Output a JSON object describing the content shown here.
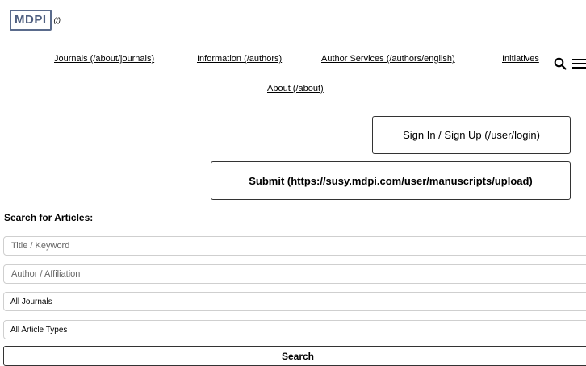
{
  "logo": {
    "text": "MDPI",
    "alt_text": "(/)"
  },
  "nav": {
    "items": [
      "Journals (/about/journals)",
      "Information (/authors)",
      "Author Services (/authors/english)",
      "Initiatives",
      "About (/about)"
    ]
  },
  "icons": {
    "search": "search-icon",
    "menu": "hamburger-menu-icon"
  },
  "auth": {
    "signin_label": "Sign In / Sign Up (/user/login)"
  },
  "submit": {
    "label": "Submit (https://susy.mdpi.com/user/manuscripts/upload)"
  },
  "search": {
    "heading": "Search for Articles:",
    "title_placeholder": "Title / Keyword",
    "author_placeholder": "Author / Affiliation",
    "journal_selected": "All Journals",
    "type_selected": "All Article Types",
    "button_label": "Search"
  }
}
